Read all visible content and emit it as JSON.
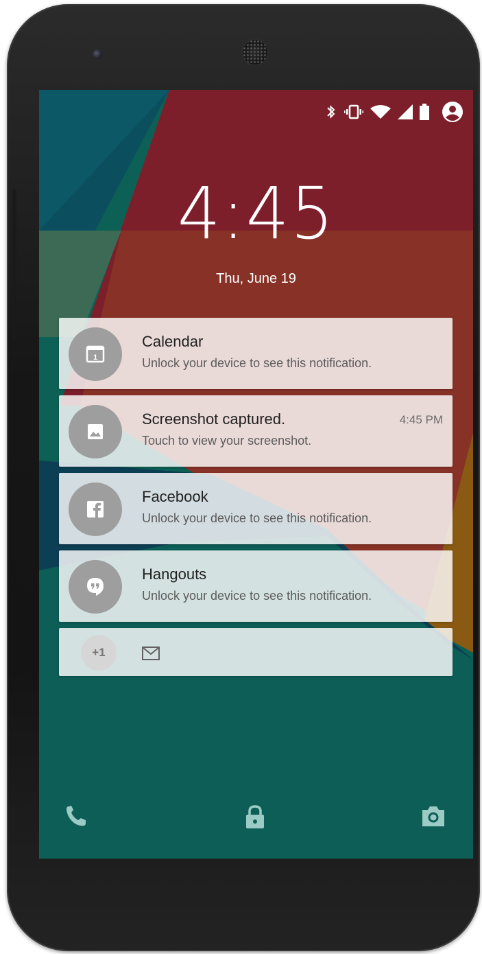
{
  "lockscreen": {
    "time": "4:45",
    "date": "Thu, June 19"
  },
  "status_bar": {
    "icons": [
      "bluetooth-icon",
      "vibrate-icon",
      "wifi-icon",
      "cell-signal-icon",
      "battery-icon",
      "user-account-icon"
    ]
  },
  "notifications": [
    {
      "app": "Calendar",
      "text": "Unlock your device to see this notification.",
      "time": "",
      "icon": "calendar-icon"
    },
    {
      "app": "Screenshot captured.",
      "text": "Touch to view your screenshot.",
      "time": "4:45 PM",
      "icon": "image-icon"
    },
    {
      "app": "Facebook",
      "text": "Unlock your device to see this notification.",
      "time": "",
      "icon": "facebook-icon"
    },
    {
      "app": "Hangouts",
      "text": "Unlock your device to see this notification.",
      "time": "",
      "icon": "hangouts-icon"
    }
  ],
  "overflow": {
    "count_label": "+1",
    "icon": "gmail-icon"
  },
  "bottom_bar": {
    "icons": [
      "phone-icon",
      "lock-icon",
      "camera-icon"
    ]
  },
  "colors": {
    "wallpaper_teal": "#0f5f57",
    "wallpaper_red": "#7f1d28",
    "wallpaper_orange": "#8a3a22",
    "notification_icon_bg": "#9e9e9e",
    "bottom_icon": "#9cc9c2"
  }
}
